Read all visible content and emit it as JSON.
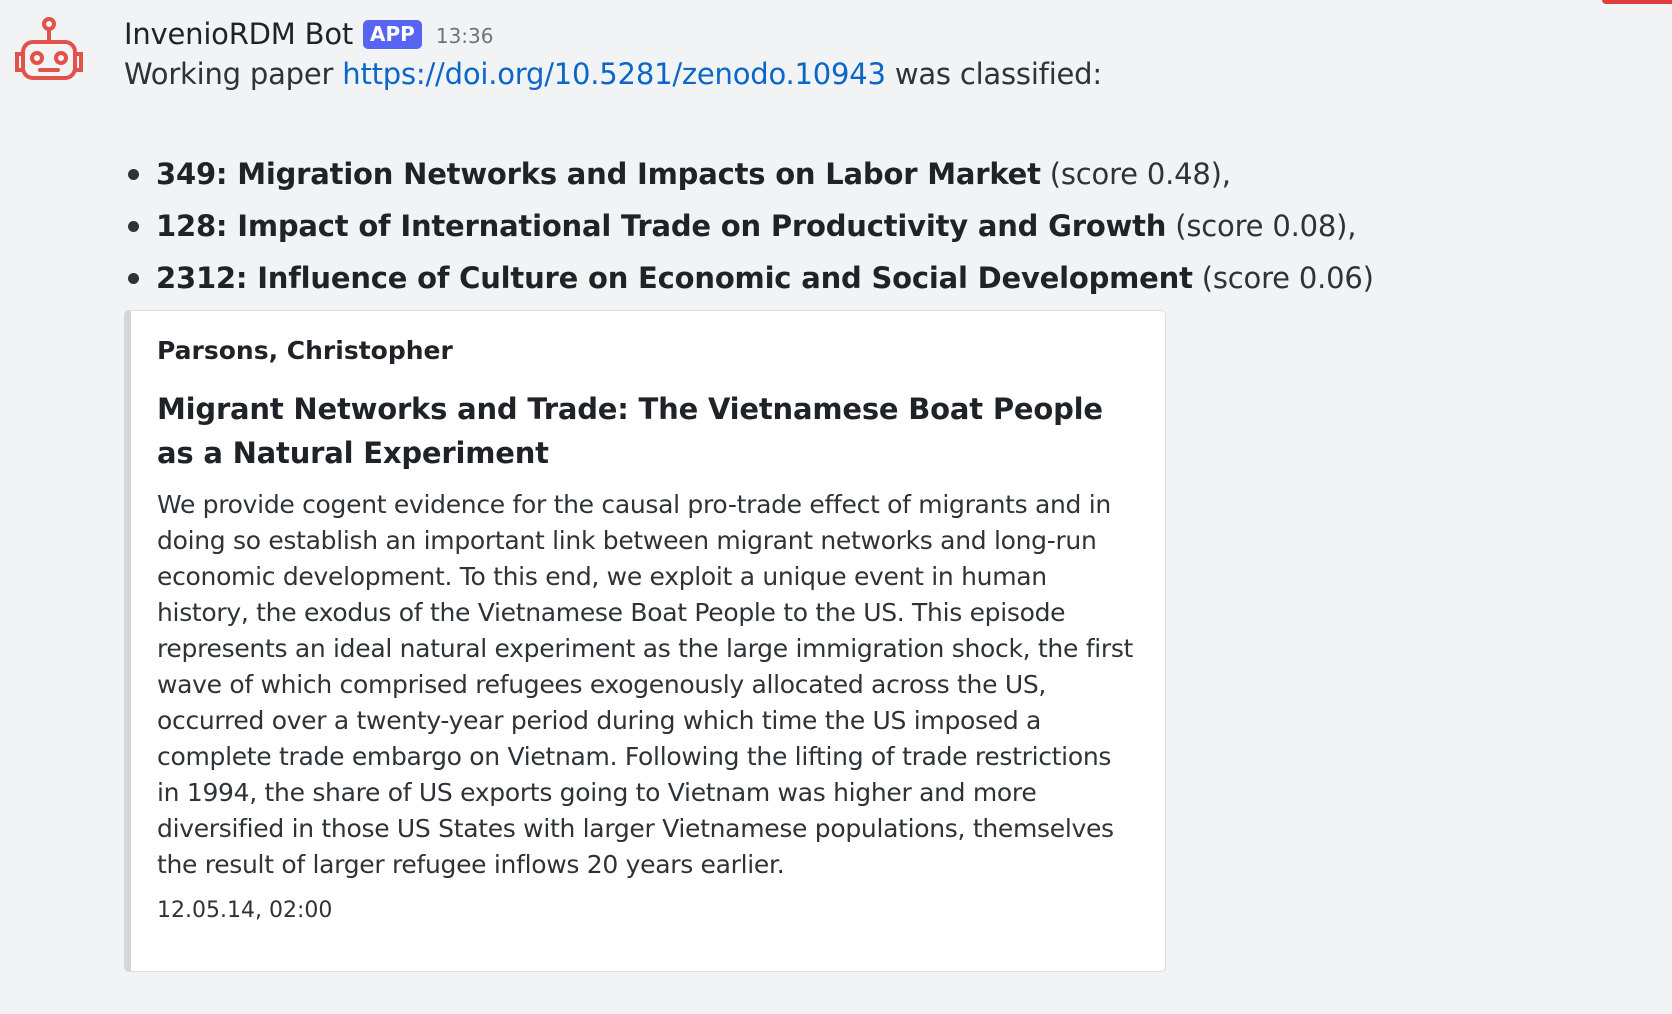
{
  "message": {
    "author": "InvenioRDM Bot",
    "app_tag": "APP",
    "timestamp": "13:36",
    "intro_prefix": "Working paper ",
    "doi_link": "https://doi.org/10.5281/zenodo.10943",
    "intro_suffix": " was classified:",
    "topics": [
      {
        "label": "349: Migration Networks and Impacts on Labor Market",
        "score": " (score 0.48),"
      },
      {
        "label": "128: Impact of International Trade on Productivity and Growth",
        "score": " (score 0.08),"
      },
      {
        "label": "2312: Influence of Culture on Economic and Social Development",
        "score": " (score 0.06)"
      }
    ],
    "embed": {
      "author": "Parsons, Christopher",
      "title": "Migrant Networks and Trade: The Vietnamese Boat People as a Natural Experiment",
      "description": "We provide cogent evidence for the causal pro-trade effect of migrants and in doing so establish an important link between migrant networks and long-run economic development. To this end, we exploit a unique event in human history, the exodus of the Vietnamese Boat People to the US. This episode represents an ideal natural experiment as the large immigration shock, the first wave of which comprised refugees exogenously allocated across the US, occurred over a twenty-year period during which time the US imposed a complete trade embargo on Vietnam. Following the lifting of trade restrictions in 1994, the share of US exports going to Vietnam was higher and more diversified in those US States with larger Vietnamese populations, themselves the result of larger refugee inflows 20 years earlier.",
      "footer": "12.05.14, 02:00"
    }
  },
  "icons": {
    "avatar": "robot-icon"
  },
  "colors": {
    "background": "#f2f3f5",
    "link": "#0a66c9",
    "app_tag": "#5865f2",
    "avatar_red": "#e0524a",
    "embed_border": "#d4d6da"
  }
}
